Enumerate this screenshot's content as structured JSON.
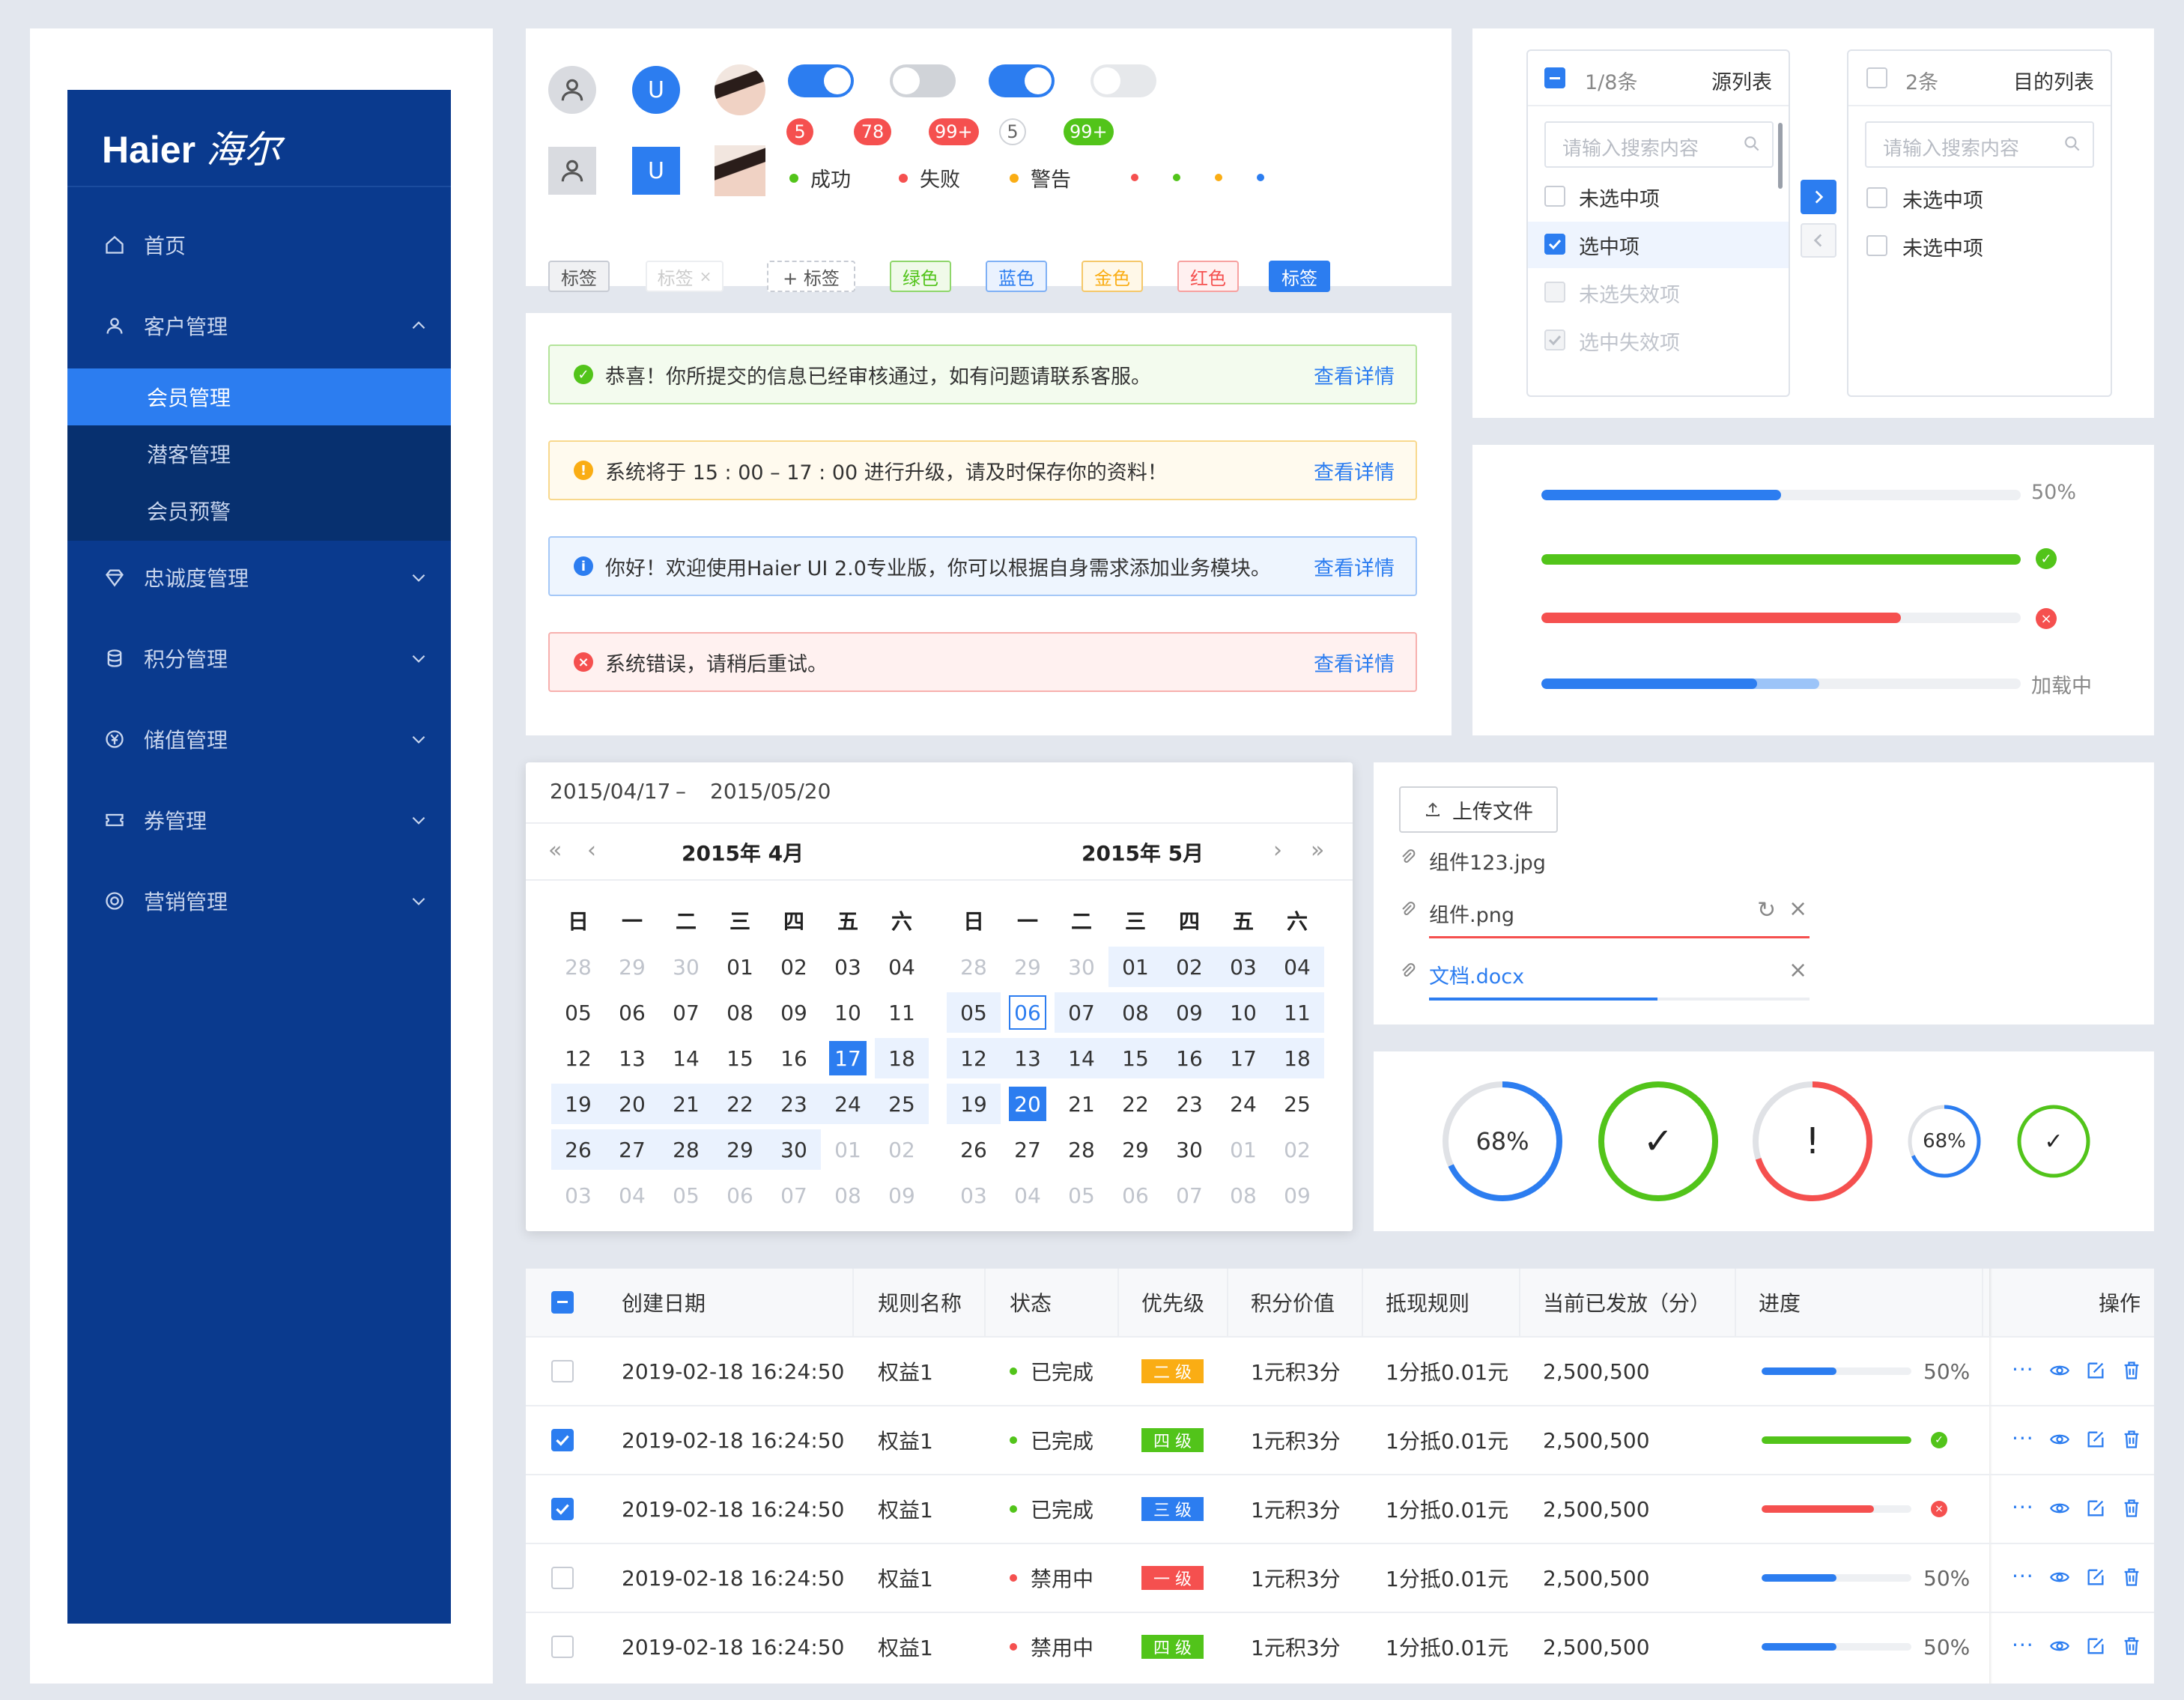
{
  "sidebar": {
    "logo_text": "Haier",
    "logo_cn": "海尔",
    "items": [
      {
        "label": "首页",
        "icon": "home-icon"
      },
      {
        "label": "客户管理",
        "icon": "user-icon"
      },
      {
        "label": "忠诚度管理",
        "icon": "diamond-icon"
      },
      {
        "label": "积分管理",
        "icon": "coins-icon"
      },
      {
        "label": "储值管理",
        "icon": "yuan-icon"
      },
      {
        "label": "券管理",
        "icon": "ticket-icon"
      },
      {
        "label": "营销管理",
        "icon": "target-icon"
      }
    ],
    "subitems": [
      "会员管理",
      "潜客管理",
      "会员预警"
    ]
  },
  "avatars": {
    "letter": "U"
  },
  "badges": [
    "5",
    "78",
    "99+",
    "5",
    "99+"
  ],
  "status": {
    "success": "成功",
    "fail": "失败",
    "warn": "警告"
  },
  "tags": [
    "标签",
    "标签",
    "+ 标签",
    "绿色",
    "蓝色",
    "金色",
    "红色",
    "标签"
  ],
  "alerts": [
    {
      "text": "恭喜！你所提交的信息已经审核通过，如有问题请联系客服。",
      "link": "查看详情",
      "type": "success"
    },
    {
      "text": "系统将于 15 : 00 – 17 : 00 进行升级，请及时保存你的资料！",
      "link": "查看详情",
      "type": "warning"
    },
    {
      "text": "你好！欢迎使用Haier UI 2.0专业版，你可以根据自身需求添加业务模块。",
      "link": "查看详情",
      "type": "info"
    },
    {
      "text": "系统错误，请稍后重试。",
      "link": "查看详情",
      "type": "error"
    }
  ],
  "transfer": {
    "source_count": "1/8条",
    "source_title": "源列表",
    "target_count": "2条",
    "target_title": "目的列表",
    "placeholder": "请输入搜索内容",
    "source_items": [
      "未选中项",
      "选中项",
      "未选失效项",
      "选中失效项"
    ],
    "target_items": [
      "未选中项",
      "未选中项"
    ]
  },
  "progress": {
    "bars": [
      {
        "value": 0.5,
        "label": "50%",
        "color": "#2c7df0",
        "state": "normal"
      },
      {
        "value": 1.0,
        "color": "#52c41a",
        "state": "success"
      },
      {
        "value": 0.75,
        "color": "#f5504f",
        "state": "error"
      },
      {
        "value": 0.45,
        "buffer": 0.58,
        "label": "加载中",
        "color": "#2c7df0",
        "state": "loading"
      }
    ]
  },
  "calendar": {
    "range_start": "2015/04/17",
    "range_sep": "–",
    "range_end": "2015/05/20",
    "left_title": "2015年 4月",
    "right_title": "2015年 5月",
    "weekdays": [
      "日",
      "一",
      "二",
      "三",
      "四",
      "五",
      "六"
    ],
    "left_days": [
      [
        "28",
        "29",
        "30",
        "01",
        "02",
        "03",
        "04"
      ],
      [
        "05",
        "06",
        "07",
        "08",
        "09",
        "10",
        "11"
      ],
      [
        "12",
        "13",
        "14",
        "15",
        "16",
        "17",
        "18"
      ],
      [
        "19",
        "20",
        "21",
        "22",
        "23",
        "24",
        "25"
      ],
      [
        "26",
        "27",
        "28",
        "29",
        "30",
        "01",
        "02"
      ],
      [
        "03",
        "04",
        "05",
        "06",
        "07",
        "08",
        "09"
      ]
    ],
    "right_days": [
      [
        "28",
        "29",
        "30",
        "01",
        "02",
        "03",
        "04"
      ],
      [
        "05",
        "06",
        "07",
        "08",
        "09",
        "10",
        "11"
      ],
      [
        "12",
        "13",
        "14",
        "15",
        "16",
        "17",
        "18"
      ],
      [
        "19",
        "20",
        "21",
        "22",
        "23",
        "24",
        "25"
      ],
      [
        "26",
        "27",
        "28",
        "29",
        "30",
        "01",
        "02"
      ],
      [
        "03",
        "04",
        "05",
        "06",
        "07",
        "08",
        "09"
      ]
    ]
  },
  "upload": {
    "button": "上传文件",
    "files": [
      {
        "name": "组件123.jpg",
        "state": "done"
      },
      {
        "name": "组件.png",
        "state": "error"
      },
      {
        "name": "文档.docx",
        "state": "uploading",
        "progress": 0.6
      }
    ]
  },
  "circles": [
    {
      "label": "68%",
      "value": 0.68,
      "color": "#2c7df0"
    },
    {
      "label": "✓",
      "value": 1.0,
      "color": "#52c41a"
    },
    {
      "label": "!",
      "value": 0.7,
      "color": "#f5504f"
    },
    {
      "label": "68%",
      "value": 0.68,
      "color": "#2c7df0"
    },
    {
      "label": "✓",
      "value": 1.0,
      "color": "#52c41a"
    }
  ],
  "table": {
    "headers": [
      "创建日期",
      "规则名称",
      "状态",
      "优先级",
      "积分价值",
      "抵现规则",
      "当前已发放（分）",
      "进度",
      "操作"
    ],
    "rows": [
      {
        "checked": false,
        "date": "2019-02-18 16:24:50",
        "name": "权益1",
        "status": "已完成",
        "status_color": "#52c41a",
        "priority": "二 级",
        "prio_color": "#faad14",
        "value": "1元积3分",
        "rule": "1分抵0.01元",
        "issued": "2,500,500",
        "progress": 0.5,
        "pcolor": "#2c7df0",
        "plabel": "50%"
      },
      {
        "checked": true,
        "date": "2019-02-18 16:24:50",
        "name": "权益1",
        "status": "已完成",
        "status_color": "#52c41a",
        "priority": "四 级",
        "prio_color": "#52c41a",
        "value": "1元积3分",
        "rule": "1分抵0.01元",
        "issued": "2,500,500",
        "progress": 1.0,
        "pcolor": "#52c41a",
        "plabel": ""
      },
      {
        "checked": true,
        "date": "2019-02-18 16:24:50",
        "name": "权益1",
        "status": "已完成",
        "status_color": "#52c41a",
        "priority": "三 级",
        "prio_color": "#2c7df0",
        "value": "1元积3分",
        "rule": "1分抵0.01元",
        "issued": "2,500,500",
        "progress": 0.75,
        "pcolor": "#f5504f",
        "plabel": ""
      },
      {
        "checked": false,
        "date": "2019-02-18 16:24:50",
        "name": "权益1",
        "status": "禁用中",
        "status_color": "#f5504f",
        "priority": "一 级",
        "prio_color": "#f5504f",
        "value": "1元积3分",
        "rule": "1分抵0.01元",
        "issued": "2,500,500",
        "progress": 0.5,
        "pcolor": "#2c7df0",
        "plabel": "50%"
      },
      {
        "checked": false,
        "date": "2019-02-18 16:24:50",
        "name": "权益1",
        "status": "禁用中",
        "status_color": "#f5504f",
        "priority": "四 级",
        "prio_color": "#52c41a",
        "value": "1元积3分",
        "rule": "1分抵0.01元",
        "issued": "2,500,500",
        "progress": 0.5,
        "pcolor": "#2c7df0",
        "plabel": "50%"
      }
    ]
  }
}
